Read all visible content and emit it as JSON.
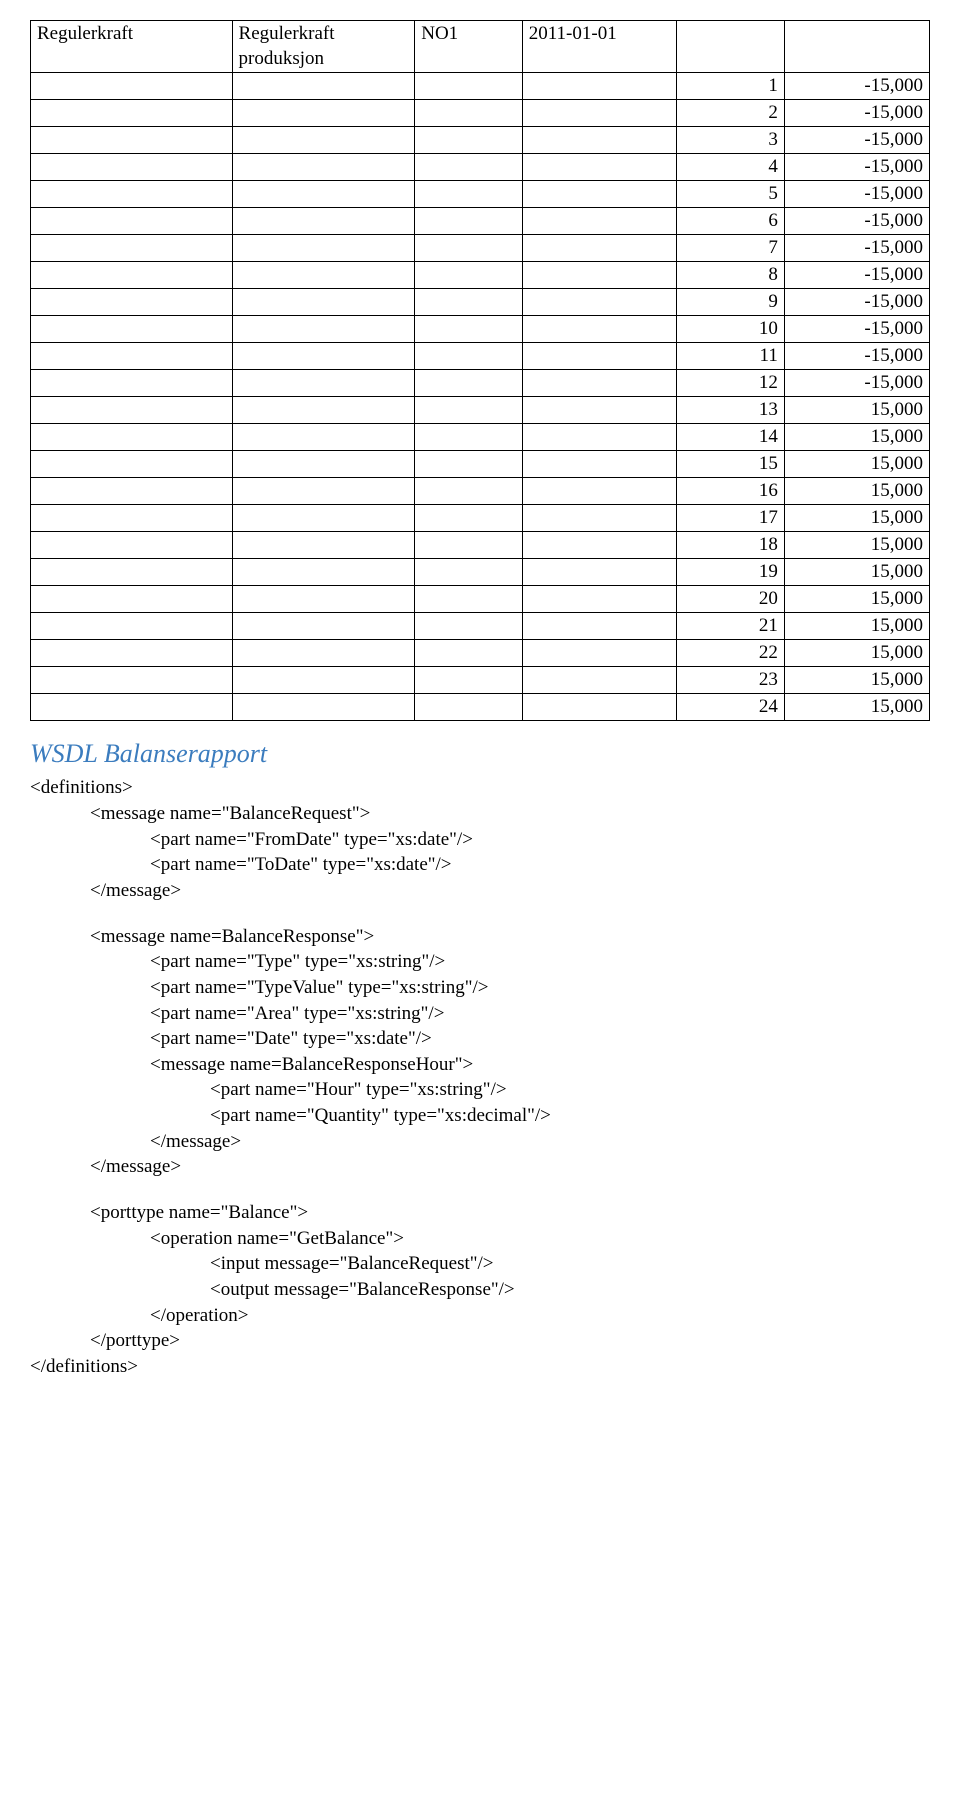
{
  "table": {
    "header": {
      "c1": "Regulerkraft",
      "c2a": "Regulerkraft",
      "c2b": "produksjon",
      "c3": "NO1",
      "c4": "2011-01-01"
    },
    "rows": [
      {
        "n": "1",
        "v": "-15,000"
      },
      {
        "n": "2",
        "v": "-15,000"
      },
      {
        "n": "3",
        "v": "-15,000"
      },
      {
        "n": "4",
        "v": "-15,000"
      },
      {
        "n": "5",
        "v": "-15,000"
      },
      {
        "n": "6",
        "v": "-15,000"
      },
      {
        "n": "7",
        "v": "-15,000"
      },
      {
        "n": "8",
        "v": "-15,000"
      },
      {
        "n": "9",
        "v": "-15,000"
      },
      {
        "n": "10",
        "v": "-15,000"
      },
      {
        "n": "11",
        "v": "-15,000"
      },
      {
        "n": "12",
        "v": "-15,000"
      },
      {
        "n": "13",
        "v": "15,000"
      },
      {
        "n": "14",
        "v": "15,000"
      },
      {
        "n": "15",
        "v": "15,000"
      },
      {
        "n": "16",
        "v": "15,000"
      },
      {
        "n": "17",
        "v": "15,000"
      },
      {
        "n": "18",
        "v": "15,000"
      },
      {
        "n": "19",
        "v": "15,000"
      },
      {
        "n": "20",
        "v": "15,000"
      },
      {
        "n": "21",
        "v": "15,000"
      },
      {
        "n": "22",
        "v": "15,000"
      },
      {
        "n": "23",
        "v": "15,000"
      },
      {
        "n": "24",
        "v": "15,000"
      }
    ]
  },
  "section_title": "WSDL Balanserapport",
  "xml": {
    "l1": "<definitions>",
    "l2": "<message name=\"BalanceRequest\">",
    "l3": "<part name=\"FromDate\" type=\"xs:date\"/>",
    "l4": "<part name=\"ToDate\" type=\"xs:date\"/>",
    "l5": "</message>",
    "l6": "<message name=BalanceResponse\">",
    "l7": "<part name=\"Type\" type=\"xs:string\"/>",
    "l8": "<part name=\"TypeValue\" type=\"xs:string\"/>",
    "l9": "<part name=\"Area\" type=\"xs:string\"/>",
    "l10": "<part name=\"Date\" type=\"xs:date\"/>",
    "l11": "<message name=BalanceResponseHour\">",
    "l12": "<part name=\"Hour\" type=\"xs:string\"/>",
    "l13": "<part name=\"Quantity\" type=\"xs:decimal\"/>",
    "l14": "</message>",
    "l15": "</message>",
    "l16": "<porttype name=\"Balance\">",
    "l17": "<operation name=\"GetBalance\">",
    "l18": "<input message=\"BalanceRequest\"/>",
    "l19": "<output message=\"BalanceResponse\"/>",
    "l20": "</operation>",
    "l21": "</porttype>",
    "l22": "</definitions>"
  }
}
